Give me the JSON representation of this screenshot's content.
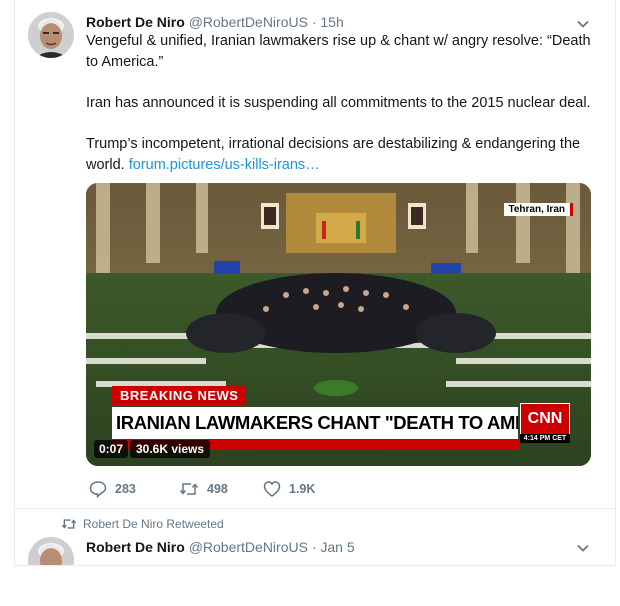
{
  "tweet": {
    "author_name": "Robert De Niro",
    "author_handle": "@RobertDeNiroUS",
    "separator": "·",
    "time": "15h",
    "text_line1": "Vengeful & unified, Iranian lawmakers rise up & chant w/ angry resolve: “Death to America.”",
    "text_line2": "Iran has announced it is suspending all commitments to the 2015 nuclear deal.",
    "text_line3": "Trump’s incompetent, irrational decisions are destabilizing & endangering the world.",
    "link_text": "forum.pictures/us-kills-irans…",
    "media": {
      "location_tag": "Tehran, Iran",
      "breaking_label": "BREAKING NEWS",
      "headline": "IRANIAN LAWMAKERS CHANT \"DEATH TO AMERICA\"",
      "network": "CNN",
      "broadcast_time": "4:14 PM CET",
      "video_time": "0:07",
      "view_count": "30.6K views"
    },
    "actions": {
      "replies": "283",
      "retweets": "498",
      "likes": "1.9K"
    }
  },
  "retweet": {
    "label": "Robert De Niro Retweeted",
    "author_name": "Robert De Niro",
    "author_handle": "@RobertDeNiroUS",
    "separator": "·",
    "time": "Jan 5"
  },
  "colors": {
    "text": "#14171a",
    "muted": "#657786",
    "link": "#1b95e0",
    "breaking_red": "#cc0000",
    "border": "#e6ecf0"
  }
}
